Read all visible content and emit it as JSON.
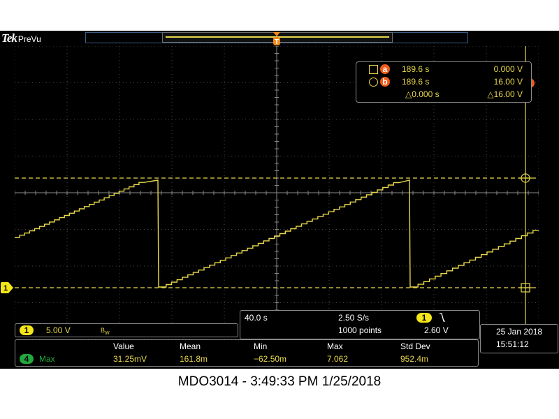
{
  "header": {
    "brand": "Tek",
    "mode": "PreVu"
  },
  "cursor_readout": {
    "badge_a": "a",
    "badge_b": "b",
    "a_time": "189.6 s",
    "a_value": "0.000 V",
    "b_time": "189.6 s",
    "b_value": "16.00 V",
    "delta_time": "△0.000 s",
    "delta_value": "△16.00 V"
  },
  "acquisition": {
    "timebase": "40.0 s",
    "sample_rate": "2.50 S/s",
    "record_length": "1000 points",
    "trigger_channel": "1",
    "trigger_slope_icon": "falling-edge-icon",
    "trigger_level": "2.60 V"
  },
  "channel1": {
    "marker": "1",
    "scale": "5.00 V",
    "bandwidth": "B",
    "bandwidth_sub": "W"
  },
  "measurements": {
    "columns": [
      "Value",
      "Mean",
      "Min",
      "Max",
      "Std Dev"
    ],
    "row": {
      "channel": "4",
      "name": "Max",
      "value": "31.25mV",
      "mean": "161.8m",
      "min": "−62.50m",
      "max": "7.062",
      "stddev": "952.4m"
    }
  },
  "datetime": {
    "date": "25 Jan  2018",
    "time": "15:51:12"
  },
  "caption": "MDO3014 - 3:49:33 PM    1/25/2018",
  "colors": {
    "trace": "#e8d84a",
    "cursor_badge": "#f05a1a",
    "ch4_badge": "#22a83c",
    "background": "#000000"
  }
}
